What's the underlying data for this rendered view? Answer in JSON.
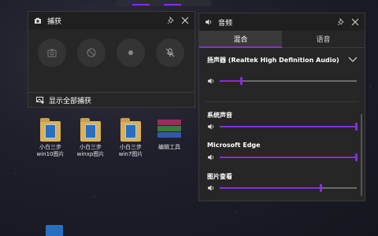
{
  "capture": {
    "title": "捕获",
    "show_all": "显示全部捕获",
    "buttons": [
      {
        "name": "screenshot-icon"
      },
      {
        "name": "record-last-icon"
      },
      {
        "name": "record-icon"
      },
      {
        "name": "mic-muted-icon"
      }
    ]
  },
  "audio": {
    "title": "音频",
    "tabs": [
      {
        "label": "混合",
        "active": true
      },
      {
        "label": "语音",
        "active": false
      }
    ],
    "device": "扬声器 (Realtek High Definition Audio)",
    "master_level": 0.16,
    "apps": [
      {
        "label": "系统声音",
        "level": 1.0
      },
      {
        "label": "Microsoft Edge",
        "level": 1.0
      },
      {
        "label": "图片查看",
        "level": 0.74
      }
    ]
  },
  "desktop": {
    "icons": [
      {
        "label_line1": "小白三步",
        "label_line2": "win10图片"
      },
      {
        "label_line1": "小白三步",
        "label_line2": "winxp图片"
      },
      {
        "label_line1": "小白三步",
        "label_line2": "win7图片"
      },
      {
        "label_line1": "编辑工具",
        "label_line2": ""
      }
    ]
  },
  "colors": {
    "accent": "#8a2be2",
    "panel": "#262626",
    "header": "#1f1f1f"
  }
}
